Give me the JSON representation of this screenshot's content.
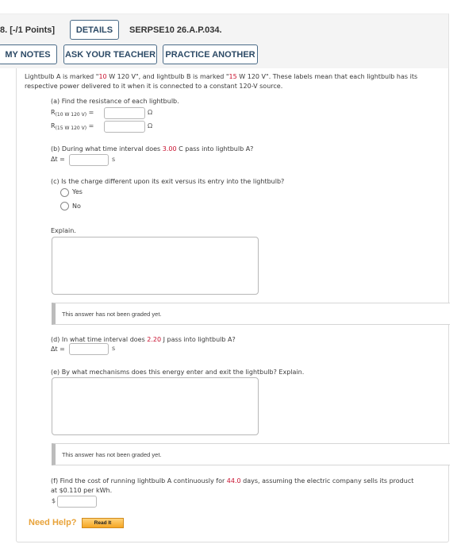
{
  "header": {
    "question_number": "8.  [-/1 Points]",
    "details_label": "DETAILS",
    "question_id": "SERPSE10 26.A.P.034.",
    "my_notes_label": "MY NOTES",
    "ask_teacher_label": "ASK YOUR TEACHER",
    "practice_another_label": "PRACTICE ANOTHER"
  },
  "intro": {
    "p1": "Lightbulb A is marked \"",
    "v1": "10",
    "p2": " W 120 V\", and lightbulb B is marked \"",
    "v2": "15",
    "p3": " W 120 V\". These labels mean that each lightbulb has its respective power delivered to it when it is connected to a constant 120-V source."
  },
  "part_a": {
    "prompt": "(a) Find the resistance of each lightbulb.",
    "r1_symbol": "R",
    "r1_sub": "(10 W 120 V)",
    "r2_symbol": "R",
    "r2_sub": "(15 W 120 V)",
    "equals": " =",
    "unit": "Ω",
    "r1_value": "",
    "r2_value": ""
  },
  "part_b": {
    "p1": "(b) During what time interval does ",
    "v": "3.00",
    "p2": " C pass into lightbulb A?",
    "label": "Δt  =",
    "unit": "s",
    "value": ""
  },
  "part_c": {
    "prompt": "(c) Is the charge different upon its exit versus its entry into the lightbulb?",
    "options": [
      "Yes",
      "No"
    ],
    "explain_label": "Explain.",
    "graded_text": "This answer has not been graded yet."
  },
  "part_d": {
    "p1": "(d) In what time interval does ",
    "v": "2.20",
    "p2": " J pass into lightbulb A?",
    "label": "Δt  =",
    "unit": "s",
    "value": ""
  },
  "part_e": {
    "prompt": "(e) By what mechanisms does this energy enter and exit the lightbulb? Explain.",
    "graded_text": "This answer has not been graded yet."
  },
  "part_f": {
    "p1": "(f) Find the cost of running lightbulb A continuously for ",
    "v": "44.0",
    "p2": " days, assuming the electric company sells its product",
    "line2": "at $0.110 per kWh.",
    "currency": "$",
    "value": ""
  },
  "help": {
    "need_help_label": "Need Help?",
    "read_it_label": "Read It"
  }
}
